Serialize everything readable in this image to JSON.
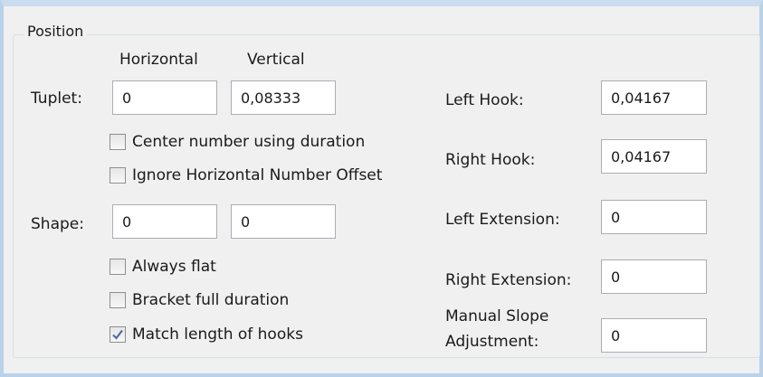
{
  "group": {
    "title": "Position"
  },
  "columns": {
    "horizontal": "Horizontal",
    "vertical": "Vertical"
  },
  "tuplet": {
    "label": "Tuplet:",
    "horizontal": "0",
    "vertical": "0,08333"
  },
  "checkboxes": {
    "center_number": {
      "label": "Center number using duration",
      "checked": false
    },
    "ignore_offset": {
      "label": "Ignore Horizontal Number Offset",
      "checked": false
    },
    "always_flat": {
      "label": "Always flat",
      "checked": false
    },
    "bracket_full": {
      "label": "Bracket full duration",
      "checked": false
    },
    "match_hooks": {
      "label": "Match length of hooks",
      "checked": true
    }
  },
  "shape": {
    "label": "Shape:",
    "horizontal": "0",
    "vertical": "0"
  },
  "right": {
    "left_hook": {
      "label": "Left Hook:",
      "value": "0,04167"
    },
    "right_hook": {
      "label": "Right Hook:",
      "value": "0,04167"
    },
    "left_extension": {
      "label": "Left Extension:",
      "value": "0"
    },
    "right_extension": {
      "label": "Right Extension:",
      "value": "0"
    },
    "manual_slope": {
      "label_line1": "Manual Slope",
      "label_line2": "Adjustment:",
      "value": "0"
    }
  },
  "colors": {
    "frame": "#b9d1ea",
    "check": "#4a6fa5"
  }
}
